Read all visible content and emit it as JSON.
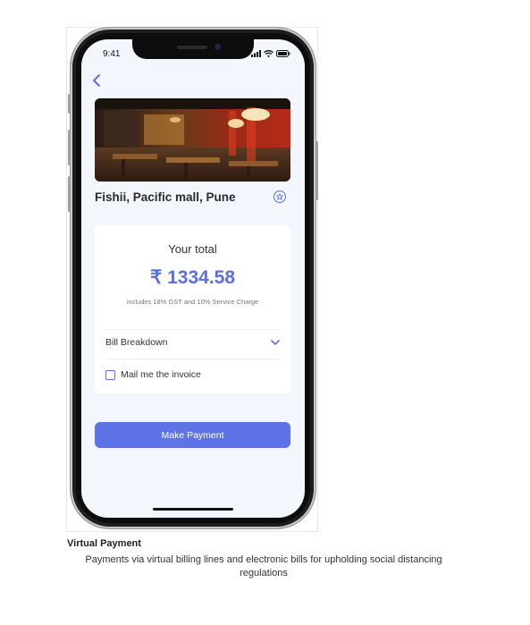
{
  "status_bar": {
    "time": "9:41"
  },
  "restaurant": {
    "name": "Fishii, Pacific mall, Pune"
  },
  "bill": {
    "heading": "Your total",
    "amount": "₹ 1334.58",
    "note": "includes 18% GST and 10% Service Charge",
    "breakdown_label": "Bill Breakdown",
    "mail_label": "Mail me the invoice",
    "mail_checked": false
  },
  "actions": {
    "pay_label": "Make Payment"
  },
  "caption": {
    "title": "Virtual Payment",
    "description": "Payments via virtual billing lines and electronic bills for upholding social distancing regulations"
  },
  "colors": {
    "accent": "#5e73e6",
    "screen_bg": "#f3f6fc"
  },
  "icons": [
    "back-chevron-icon",
    "star-icon",
    "chevron-down-icon",
    "signal-icon",
    "wifi-icon",
    "battery-icon"
  ]
}
